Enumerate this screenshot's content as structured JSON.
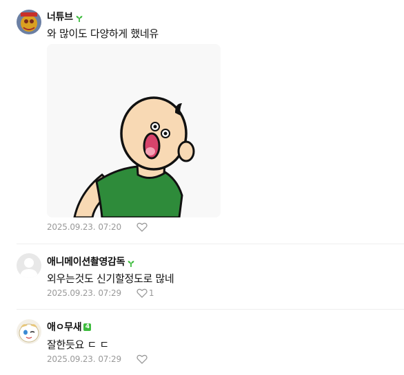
{
  "comments": [
    {
      "author": "너튜브",
      "text": "와 많이도 다양하게 했네유",
      "date": "2025.09.23.",
      "time": "07:20",
      "likes": "",
      "badge": "sprout-badge-icon"
    },
    {
      "author": "애니메이션촬영감독",
      "text": "외우는것도 신기할정도로 많네",
      "date": "2025.09.23.",
      "time": "07:29",
      "likes": "1",
      "badge": "sprout-badge-icon"
    },
    {
      "author": "애ㅇ무새",
      "text": "잘한듯요 ㄷ ㄷ",
      "date": "2025.09.23.",
      "time": "07:29",
      "likes": "",
      "badge": "level-4-badge-icon"
    }
  ],
  "badge_text": "4",
  "colors": {
    "sprout": "#3dbc3d",
    "meta": "#999999",
    "divider": "#eeeeee",
    "shirt": "#2e8b3a",
    "skin": "#f8d9b4"
  },
  "icons": [
    "heart-icon",
    "sprout-badge-icon",
    "level-4-badge-icon"
  ]
}
